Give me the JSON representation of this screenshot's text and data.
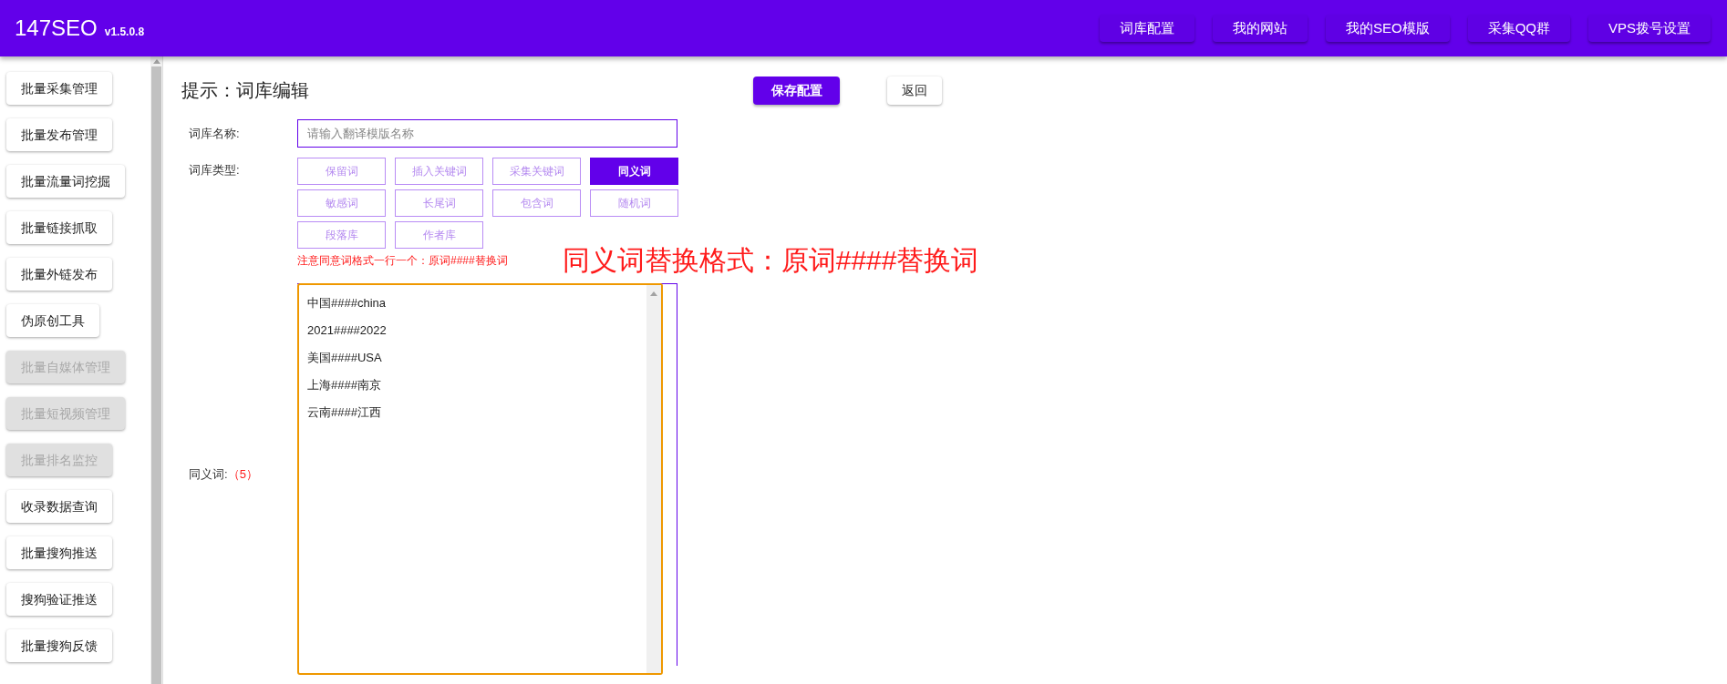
{
  "header": {
    "logo": "147SEO",
    "version": "v1.5.0.8",
    "nav": [
      "词库配置",
      "我的网站",
      "我的SEO模版",
      "采集QQ群",
      "VPS拨号设置"
    ]
  },
  "sidebar": {
    "items": [
      {
        "label": "批量采集管理",
        "disabled": false
      },
      {
        "label": "批量发布管理",
        "disabled": false
      },
      {
        "label": "批量流量词挖掘",
        "disabled": false
      },
      {
        "label": "批量链接抓取",
        "disabled": false
      },
      {
        "label": "批量外链发布",
        "disabled": false
      },
      {
        "label": "伪原创工具",
        "disabled": false
      },
      {
        "label": "批量自媒体管理",
        "disabled": true
      },
      {
        "label": "批量短视频管理",
        "disabled": true
      },
      {
        "label": "批量排名监控",
        "disabled": true
      },
      {
        "label": "收录数据查询",
        "disabled": false
      },
      {
        "label": "批量搜狗推送",
        "disabled": false
      },
      {
        "label": "搜狗验证推送",
        "disabled": false
      },
      {
        "label": "批量搜狗反馈",
        "disabled": false
      }
    ]
  },
  "page": {
    "title": "提示：词库编辑",
    "save_button": "保存配置",
    "back_button": "返回"
  },
  "form": {
    "name_label": "词库名称:",
    "name_placeholder": "请输入翻译模版名称",
    "type_label": "词库类型:",
    "types": [
      {
        "label": "保留词",
        "selected": false
      },
      {
        "label": "插入关键词",
        "selected": false
      },
      {
        "label": "采集关键词",
        "selected": false
      },
      {
        "label": "同义词",
        "selected": true
      },
      {
        "label": "敏感词",
        "selected": false
      },
      {
        "label": "长尾词",
        "selected": false
      },
      {
        "label": "包含词",
        "selected": false
      },
      {
        "label": "随机词",
        "selected": false
      },
      {
        "label": "段落库",
        "selected": false
      },
      {
        "label": "作者库",
        "selected": false
      }
    ],
    "note": "注意同意词格式一行一个：原词####替换词",
    "annotation": "同义词替换格式：原词####替换词",
    "words_label": "同义词:",
    "words_count": "（5）",
    "words": [
      "中国####china",
      "2021####2022",
      "美国####USA",
      "上海####南京",
      "云南####江西"
    ]
  }
}
